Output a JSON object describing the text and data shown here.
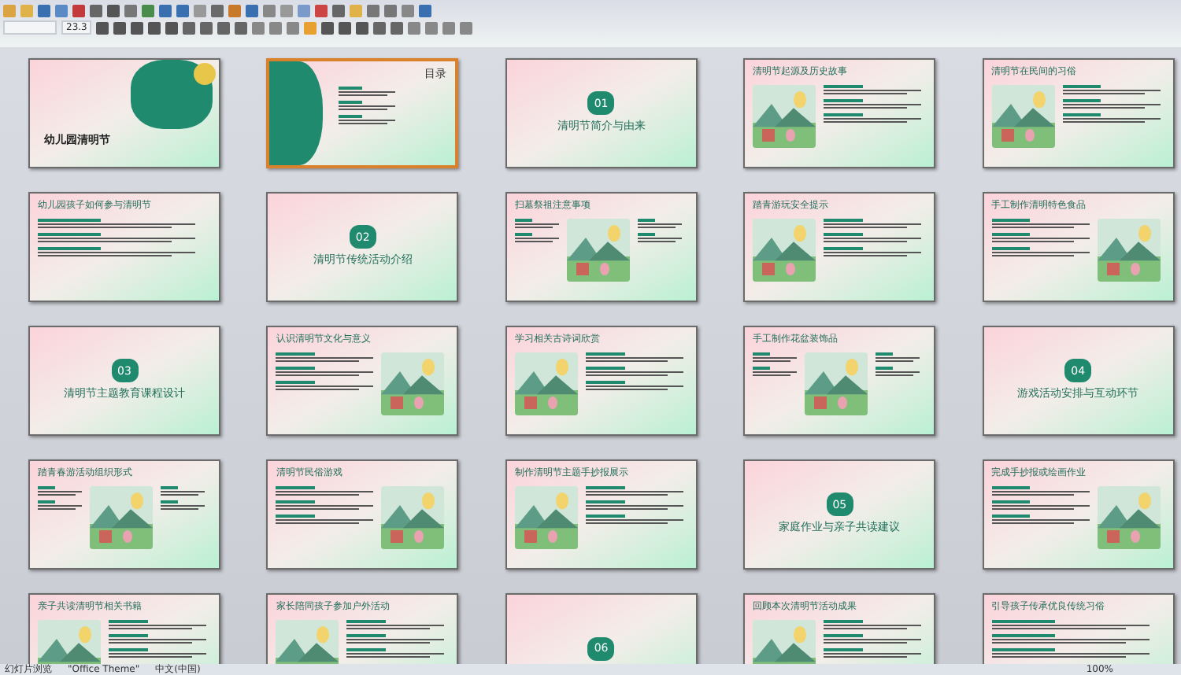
{
  "toolbar": {
    "font_size": "23.3"
  },
  "slides": [
    {
      "kind": "title",
      "title": "幼儿园清明节",
      "selected": false
    },
    {
      "kind": "toc",
      "title": "目录",
      "selected": true
    },
    {
      "kind": "section",
      "number": "01",
      "title": "清明节简介与由来",
      "selected": false
    },
    {
      "kind": "picture-left",
      "title": "清明节起源及历史故事",
      "selected": false
    },
    {
      "kind": "picture-left",
      "title": "清明节在民间的习俗",
      "selected": false
    },
    {
      "kind": "text",
      "title": "幼儿园孩子如何参与清明节",
      "selected": false
    },
    {
      "kind": "section",
      "number": "02",
      "title": "清明节传统活动介绍",
      "selected": false
    },
    {
      "kind": "picture-center",
      "title": "扫墓祭祖注意事项",
      "selected": false
    },
    {
      "kind": "picture-left",
      "title": "踏青游玩安全提示",
      "selected": false
    },
    {
      "kind": "picture-right",
      "title": "手工制作清明特色食品",
      "selected": false
    },
    {
      "kind": "section",
      "number": "03",
      "title": "清明节主题教育课程设计",
      "selected": false
    },
    {
      "kind": "picture-right",
      "title": "认识清明节文化与意义",
      "selected": false
    },
    {
      "kind": "picture-left",
      "title": "学习相关古诗词欣赏",
      "selected": false
    },
    {
      "kind": "picture-center",
      "title": "手工制作花盆装饰品",
      "selected": false
    },
    {
      "kind": "section",
      "number": "04",
      "title": "游戏活动安排与互动环节",
      "selected": false
    },
    {
      "kind": "picture-center",
      "title": "踏青春游活动组织形式",
      "selected": false
    },
    {
      "kind": "picture-right",
      "title": "清明节民俗游戏",
      "selected": false
    },
    {
      "kind": "picture-left",
      "title": "制作清明节主题手抄报展示",
      "selected": false
    },
    {
      "kind": "section",
      "number": "05",
      "title": "家庭作业与亲子共读建议",
      "selected": false
    },
    {
      "kind": "picture-right",
      "title": "完成手抄报或绘画作业",
      "selected": false
    },
    {
      "kind": "picture-left",
      "title": "亲子共读清明节相关书籍",
      "selected": false
    },
    {
      "kind": "picture-left",
      "title": "家长陪同孩子参加户外活动",
      "selected": false
    },
    {
      "kind": "section",
      "number": "06",
      "selected": false
    },
    {
      "kind": "picture-left",
      "title": "回顾本次清明节活动成果",
      "selected": false
    },
    {
      "kind": "text",
      "title": "引导孩子传承优良传统习俗",
      "selected": false
    }
  ],
  "status_bar": {
    "view": "幻灯片浏览",
    "theme": "\"Office Theme\"",
    "language": "中文(中国)",
    "zoom": "100%"
  }
}
